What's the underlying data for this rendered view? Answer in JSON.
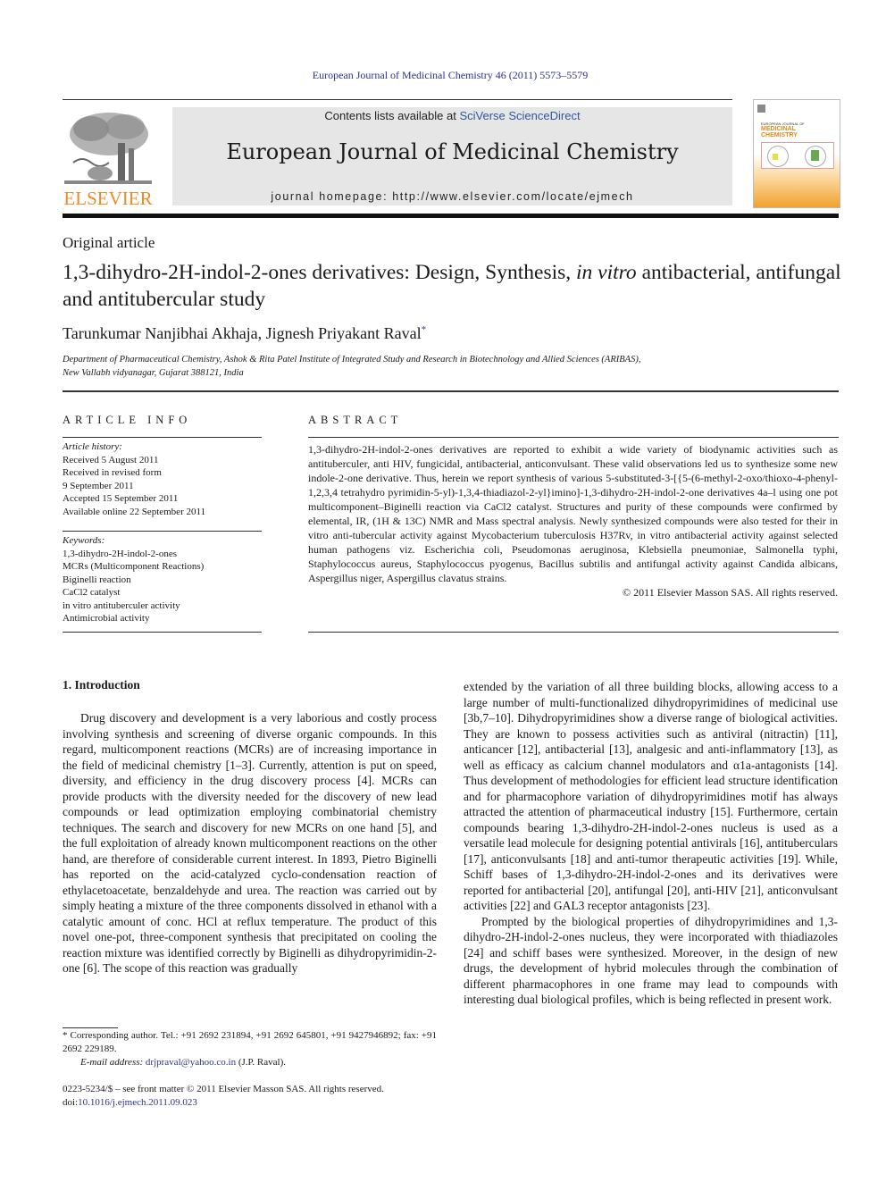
{
  "header": {
    "citation": "European Journal of Medicinal Chemistry 46 (2011) 5573–5579",
    "publisher_wordmark": "ELSEVIER",
    "contents_prefix": "Contents lists available at ",
    "contents_link": "SciVerse ScienceDirect",
    "journal_title": "European Journal of Medicinal Chemistry",
    "homepage": "journal homepage: http://www.elsevier.com/locate/ejmech",
    "cover": {
      "line1": "EUROPEAN JOURNAL OF",
      "line2": "MEDICINAL",
      "line3": "CHEMISTRY"
    },
    "colors": {
      "link": "#2a3590",
      "elsevier_orange": "#f08a24",
      "banner_bg": "#e6e6e6"
    }
  },
  "article": {
    "type": "Original article",
    "title_part1": "1,3-dihydro-2H-indol-2-ones derivatives: Design, Synthesis, ",
    "title_italic": "in vitro",
    "title_part2": " antibacterial, antifungal and antitubercular study",
    "authors": "Tarunkumar Nanjibhai Akhaja, Jignesh Priyakant Raval",
    "author_mark": "*",
    "affiliation_line1": "Department of Pharmaceutical Chemistry, Ashok & Rita Patel Institute of Integrated Study and Research in Biotechnology and Allied Sciences (ARIBAS),",
    "affiliation_line2": "New Vallabh vidyanagar, Gujarat 388121, India"
  },
  "article_info": {
    "heading": "ARTICLE INFO",
    "history_label": "Article history:",
    "history": [
      "Received 5 August 2011",
      "Received in revised form",
      "9 September 2011",
      "Accepted 15 September 2011",
      "Available online 22 September 2011"
    ],
    "keywords_label": "Keywords:",
    "keywords": [
      "1,3-dihydro-2H-indol-2-ones",
      "MCRs (Multicomponent Reactions)",
      "Biginelli reaction",
      "CaCl2 catalyst",
      "in vitro antituberculer activity",
      "Antimicrobial activity"
    ]
  },
  "abstract": {
    "heading": "ABSTRACT",
    "text": "1,3-dihydro-2H-indol-2-ones derivatives are reported to exhibit a wide variety of biodynamic activities such as antituberculer, anti HIV, fungicidal, antibacterial, anticonvulsant. These valid observations led us to synthesize some new indole-2-one derivative. Thus, herein we report synthesis of various 5-substituted-3-[{5-(6-methyl-2-oxo/thioxo-4-phenyl-1,2,3,4 tetrahydro pyrimidin-5-yl)-1,3,4-thiadiazol-2-yl}imino]-1,3-dihydro-2H-indol-2-one derivatives 4a–l using one pot multicomponent–Biginelli reaction via CaCl2 catalyst. Structures and purity of these compounds were confirmed by elemental, IR, (1H & 13C) NMR and Mass spectral analysis. Newly synthesized compounds were also tested for their in vitro anti-tubercular activity against Mycobacterium tuberculosis H37Rv, in vitro antibacterial activity against selected human pathogens viz. Escherichia coli, Pseudomonas aeruginosa, Klebsiella pneumoniae, Salmonella typhi, Staphylococcus aureus, Staphylococcus pyogenus, Bacillus subtilis and antifungal activity against Candida albicans, Aspergillus niger, Aspergillus clavatus strains.",
    "copyright": "© 2011 Elsevier Masson SAS. All rights reserved."
  },
  "introduction": {
    "heading": "1.  Introduction",
    "left_paragraph": "Drug discovery and development is a very laborious and costly process involving synthesis and screening of diverse organic compounds. In this regard, multicomponent reactions (MCRs) are of increasing importance in the field of medicinal chemistry [1–3]. Currently, attention is put on speed, diversity, and efficiency in the drug discovery process [4]. MCRs can provide products with the diversity needed for the discovery of new lead compounds or lead optimization employing combinatorial chemistry techniques. The search and discovery for new MCRs on one hand [5], and the full exploitation of already known multicomponent reactions on the other hand, are therefore of considerable current interest. In 1893, Pietro Biginelli has reported on the acid-catalyzed cyclo-condensation reaction of ethylacetoacetate, benzaldehyde and urea. The reaction was carried out by simply heating a mixture of the three components dissolved in ethanol with a catalytic amount of conc. HCl at reflux temperature. The product of this novel one-pot, three-component synthesis that precipitated on cooling the reaction mixture was identified correctly by Biginelli as dihydropyrimidin-2-one [6]. The scope of this reaction was gradually",
    "right_paragraph1": "extended by the variation of all three building blocks, allowing access to a large number of multi-functionalized dihydropyrimidines of medicinal use [3b,7–10]. Dihydropyrimidines show a diverse range of biological activities. They are known to possess activities such as antiviral (nitractin) [11], anticancer [12], antibacterial [13], analgesic and anti-inflammatory [13], as well as efficacy as calcium channel modulators and α1a-antagonists [14]. Thus development of methodologies for efficient lead structure identification and for pharmacophore variation of dihydropyrimidines motif has always attracted the attention of pharmaceutical industry [15]. Furthermore, certain compounds bearing 1,3-dihydro-2H-indol-2-ones nucleus is used as a versatile lead molecule for designing potential antivirals [16], antituberculars [17], anticonvulsants [18] and anti-tumor therapeutic activities [19]. While, Schiff bases of 1,3-dihydro-2H-indol-2-ones and its derivatives were reported for antibacterial [20], antifungal [20], anti-HIV [21], anticonvulsant activities [22] and GAL3 receptor antagonists [23].",
    "right_paragraph2": "Prompted by the biological properties of dihydropyrimidines and 1,3-dihydro-2H-indol-2-ones nucleus, they were incorporated with thiadiazoles [24] and schiff bases were synthesized. Moreover, in the design of new drugs, the development of hybrid molecules through the combination of different pharmacophores in one frame may lead to compounds with interesting dual biological profiles, which is being reflected in present work."
  },
  "footnote": {
    "corresponding": "* Corresponding author. Tel.: +91 2692 231894, +91 2692 645801, +91 9427946892; fax: +91 2692 229189.",
    "email_label": "E-mail address: ",
    "email": "drjpraval@yahoo.co.in",
    "email_suffix": " (J.P. Raval).",
    "issn": "0223-5234/$ – see front matter © 2011 Elsevier Masson SAS. All rights reserved.",
    "doi_label": "doi:",
    "doi": "10.1016/j.ejmech.2011.09.023"
  }
}
